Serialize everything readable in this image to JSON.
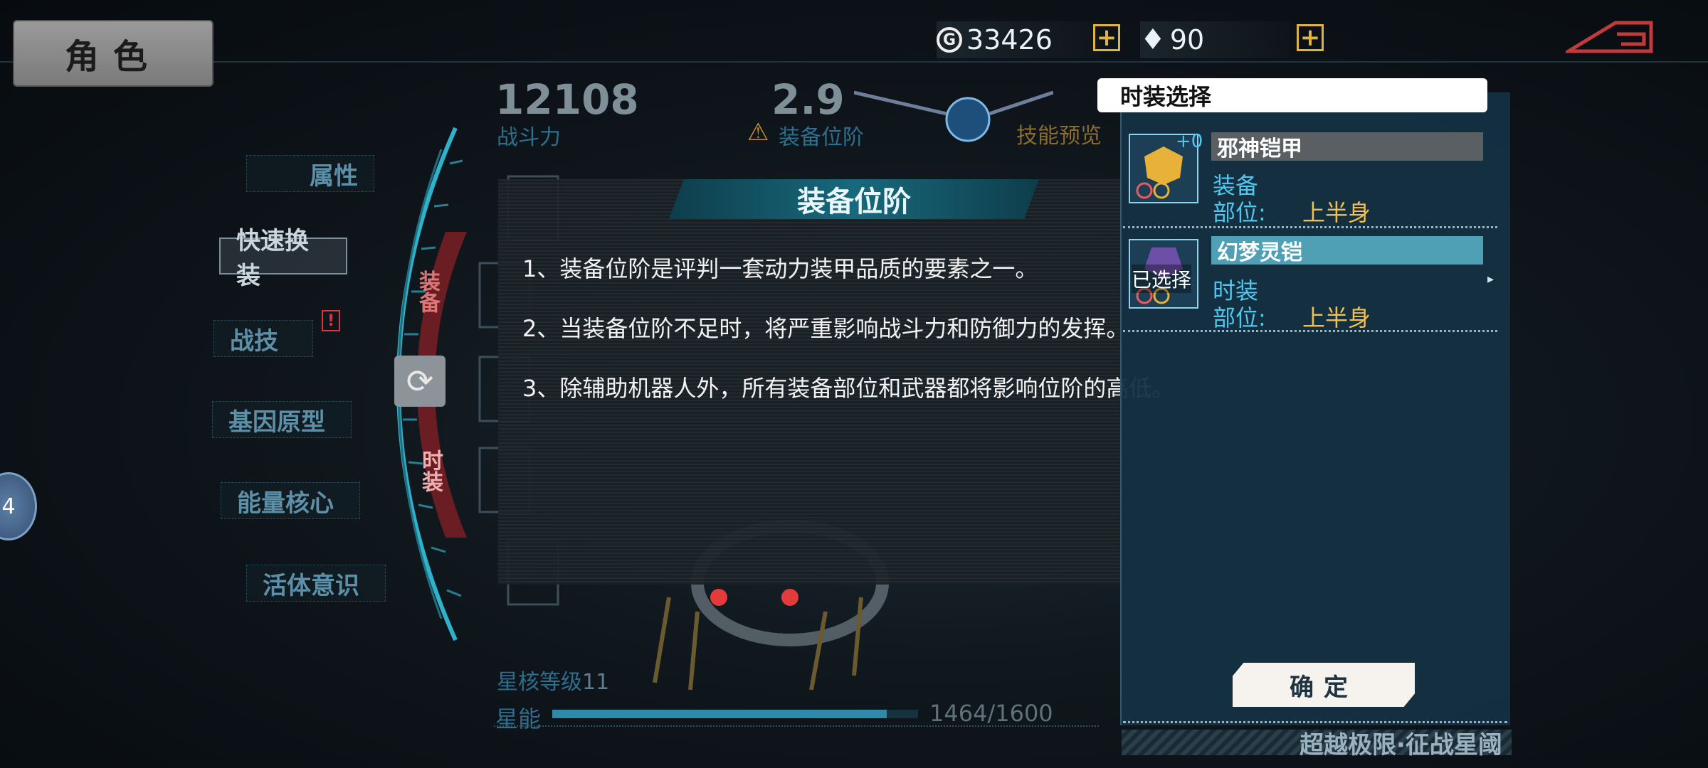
{
  "header": {
    "title": "角色",
    "gold": "33426",
    "gems": "90"
  },
  "stats": {
    "power_value": "12108",
    "power_label": "战斗力",
    "tier_value": "2.9",
    "tier_label": "装备位阶",
    "skill_preview": "技能预览"
  },
  "menu": {
    "items": [
      "属性",
      "快速换装",
      "战技",
      "基因原型",
      "能量核心",
      "活体意识"
    ],
    "alert": "!"
  },
  "level_badge": "4",
  "side_tabs": {
    "equip": "装备",
    "costume": "时装"
  },
  "info_popup": {
    "title": "装备位阶",
    "lines": [
      "1、装备位阶是评判一套动力装甲品质的要素之一。",
      "2、当装备位阶不足时，将严重影响战斗力和防御力的发挥。",
      "3、除辅助机器人外，所有装备部位和武器都将影响位阶的高低。"
    ]
  },
  "costume_panel": {
    "title": "时装选择",
    "items": [
      {
        "plus": "+0",
        "name": "邪神铠甲",
        "type": "装备",
        "slot_label": "部位:",
        "slot_value": "上半身"
      },
      {
        "selected_label": "已选择",
        "name": "幻梦灵铠",
        "type": "时装",
        "slot_label": "部位:",
        "slot_value": "上半身"
      }
    ],
    "confirm": "确定",
    "slogan": "超越极限·征战星阈"
  },
  "star_core": {
    "level_label": "星核等级",
    "level": "11",
    "energy_label": "星能",
    "current": 1464,
    "max": 1600,
    "text": "1464/1600"
  },
  "colors": {
    "accent": "#4fc7ef",
    "gold": "#f4c04d",
    "panel": "#143042"
  }
}
